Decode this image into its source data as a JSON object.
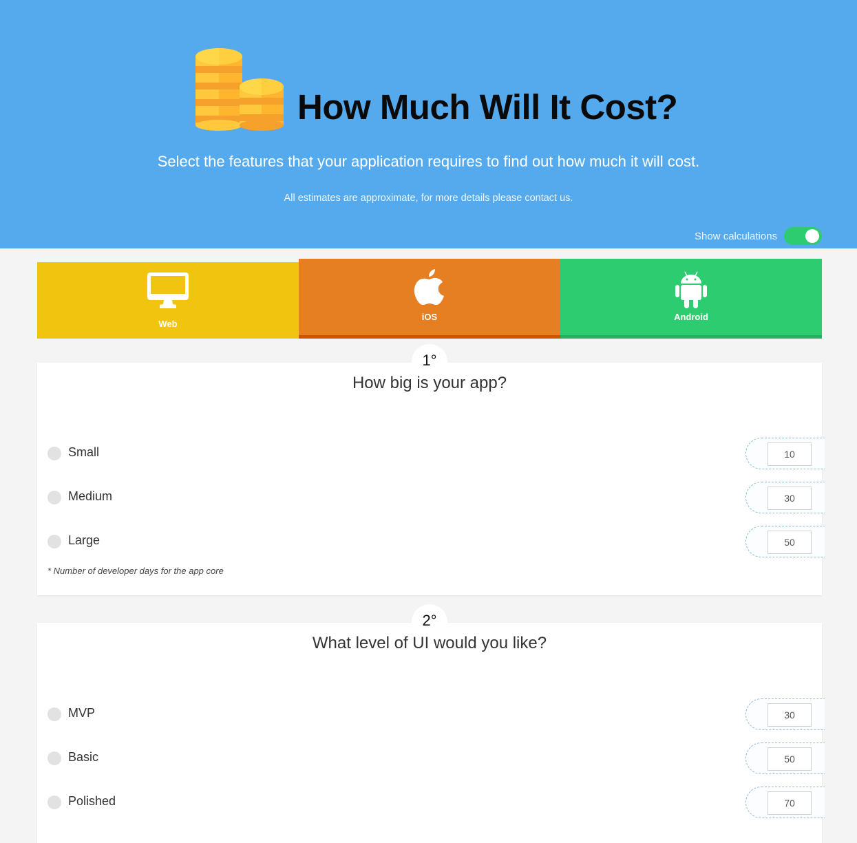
{
  "hero": {
    "title": "How Much Will It Cost?",
    "subtitle": "Select the features that your application requires to find out how much it will cost.",
    "note": "All estimates are approximate, for more details please contact us.",
    "toggle_label": "Show calculations",
    "toggle_on": true,
    "logo_icon": "coins-stack-icon"
  },
  "colors": {
    "hero_bg": "#55aaed",
    "web": "#f1c40f",
    "ios": "#e67e22",
    "android": "#2ecc71",
    "toggle": "#2ecc71"
  },
  "platforms": [
    {
      "label": "Web",
      "icon": "desktop-monitor-icon"
    },
    {
      "label": "iOS",
      "icon": "apple-icon"
    },
    {
      "label": "Android",
      "icon": "android-icon"
    }
  ],
  "questions": [
    {
      "step": "1°",
      "title": "How big is your app?",
      "options": [
        {
          "label": "Small",
          "days": "10"
        },
        {
          "label": "Medium",
          "days": "30"
        },
        {
          "label": "Large",
          "days": "50"
        }
      ],
      "footnote": "* Number of developer days for the app core"
    },
    {
      "step": "2°",
      "title": "What level of UI would you like?",
      "options": [
        {
          "label": "MVP",
          "days": "30"
        },
        {
          "label": "Basic",
          "days": "50"
        },
        {
          "label": "Polished",
          "days": "70"
        }
      ]
    }
  ]
}
